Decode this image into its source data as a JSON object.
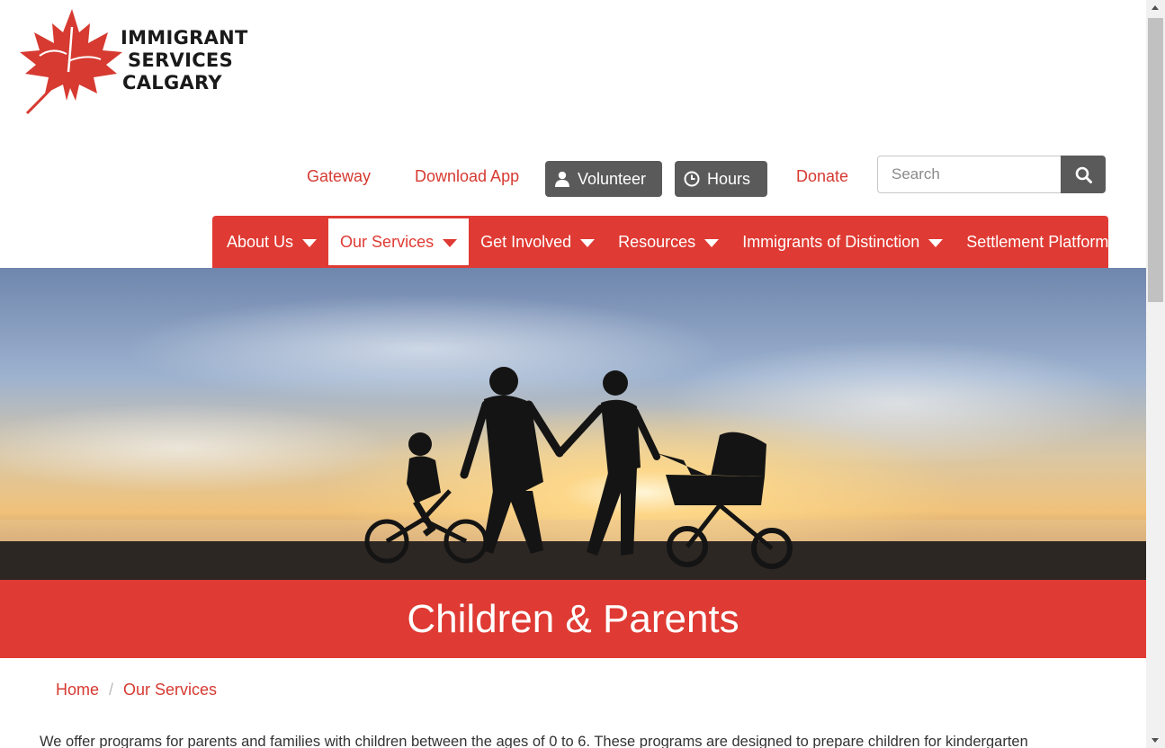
{
  "logo": {
    "line1": "IMMIGRANT",
    "line2": "SERVICES",
    "line3": "CALGARY",
    "icon": "maple-leaf-icon",
    "color": "#d63a31"
  },
  "utility": {
    "gateway": "Gateway",
    "download_app": "Download App",
    "volunteer": "Volunteer",
    "hours": "Hours",
    "donate": "Donate",
    "search_placeholder": "Search"
  },
  "nav": {
    "items": [
      {
        "label": "About Us",
        "dropdown": true,
        "active": false
      },
      {
        "label": "Our Services",
        "dropdown": true,
        "active": true
      },
      {
        "label": "Get Involved",
        "dropdown": true,
        "active": false
      },
      {
        "label": "Resources",
        "dropdown": true,
        "active": false
      },
      {
        "label": "Immigrants of Distinction",
        "dropdown": true,
        "active": false
      },
      {
        "label": "Settlement Platform",
        "dropdown": false,
        "active": false
      }
    ]
  },
  "page": {
    "title": "Children & Parents",
    "intro": "We offer programs for parents and families with children between the ages of 0 to 6. These programs are designed to prepare children for kindergarten"
  },
  "breadcrumb": {
    "home": "Home",
    "section": "Our Services"
  },
  "colors": {
    "brand_red": "#df3a33",
    "link_red": "#d63a31",
    "button_gray": "#5a5a5a"
  }
}
